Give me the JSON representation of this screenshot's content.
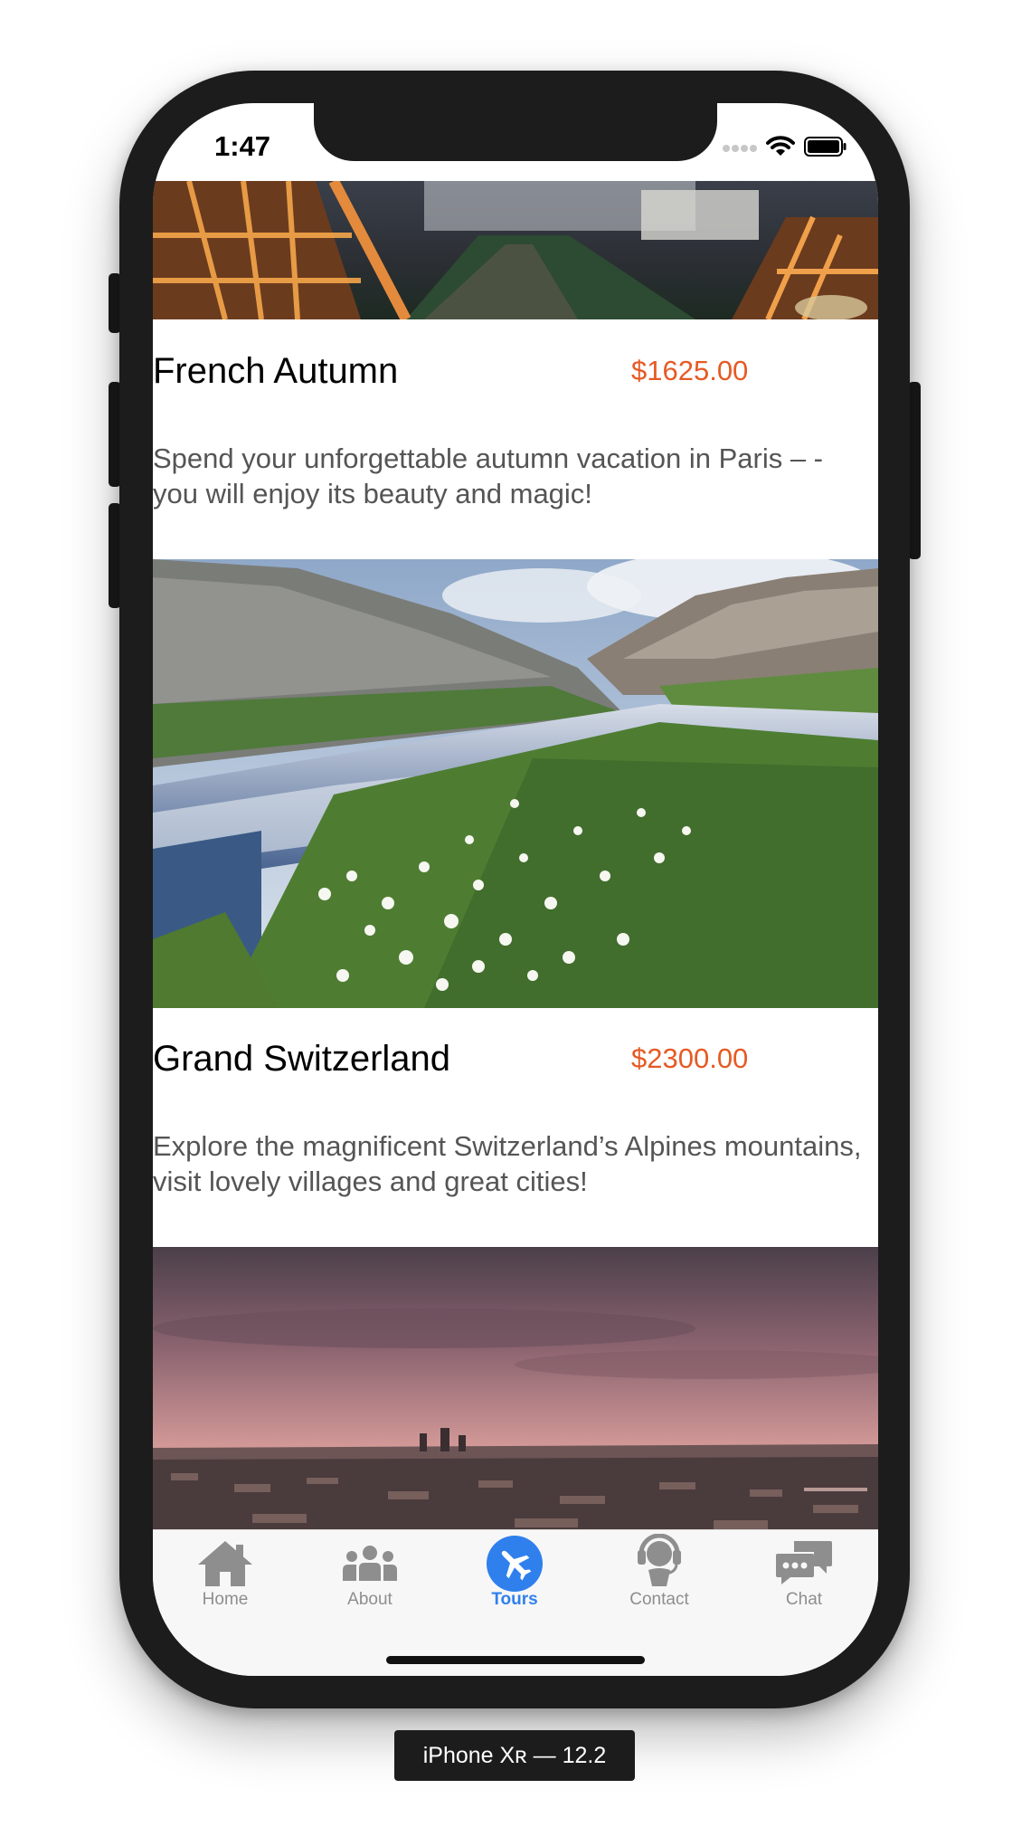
{
  "status_bar": {
    "time": "1:47"
  },
  "tours": [
    {
      "title": "French Autumn",
      "price": "$1625.00",
      "description": "Spend your unforgettable autumn vacation in Paris – - you will enjoy its beauty and magic!",
      "image": "paris-eiffel-tower-night-photo"
    },
    {
      "title": "Grand Switzerland",
      "price": "$2300.00",
      "description": "Explore the magnificent Switzerland’s Alpines mountains, visit lovely villages and great cities!",
      "image": "alpine-stream-meadow-photo"
    },
    {
      "image": "city-skyline-sunset-photo"
    }
  ],
  "tab_bar": {
    "items": [
      {
        "label": "Home",
        "icon": "home-icon",
        "active": false
      },
      {
        "label": "About",
        "icon": "group-icon",
        "active": false
      },
      {
        "label": "Tours",
        "icon": "airplane-icon",
        "active": true
      },
      {
        "label": "Contact",
        "icon": "headset-icon",
        "active": false
      },
      {
        "label": "Chat",
        "icon": "chat-bubbles-icon",
        "active": false
      }
    ]
  },
  "colors": {
    "price": "#e65a24",
    "active_tab": "#2f80ed",
    "inactive_tab": "#8e8e8e"
  },
  "device_label": "iPhone Xʀ — 12.2"
}
